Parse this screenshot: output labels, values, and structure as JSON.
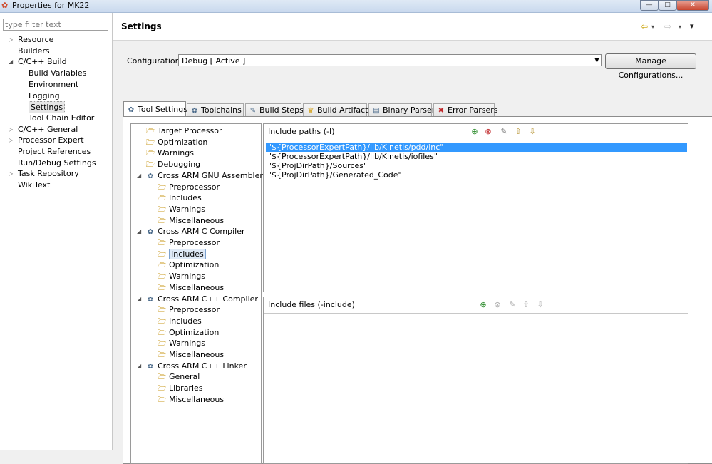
{
  "window": {
    "title": "Properties for MK22",
    "minimize": "—",
    "maximize": "□",
    "close": "✕"
  },
  "filter": {
    "placeholder": "type filter text"
  },
  "nav": [
    {
      "label": "Resource",
      "indent": 1,
      "twist": "▷"
    },
    {
      "label": "Builders",
      "indent": 1,
      "twist": ""
    },
    {
      "label": "C/C++ Build",
      "indent": 1,
      "twist": "◢"
    },
    {
      "label": "Build Variables",
      "indent": 2,
      "twist": ""
    },
    {
      "label": "Environment",
      "indent": 2,
      "twist": ""
    },
    {
      "label": "Logging",
      "indent": 2,
      "twist": ""
    },
    {
      "label": "Settings",
      "indent": 2,
      "twist": "",
      "selected": true
    },
    {
      "label": "Tool Chain Editor",
      "indent": 2,
      "twist": ""
    },
    {
      "label": "C/C++ General",
      "indent": 1,
      "twist": "▷"
    },
    {
      "label": "Processor Expert",
      "indent": 1,
      "twist": "▷"
    },
    {
      "label": "Project References",
      "indent": 1,
      "twist": ""
    },
    {
      "label": "Run/Debug Settings",
      "indent": 1,
      "twist": ""
    },
    {
      "label": "Task Repository",
      "indent": 1,
      "twist": "▷"
    },
    {
      "label": "WikiText",
      "indent": 1,
      "twist": ""
    }
  ],
  "header": {
    "title": "Settings",
    "back": "⇦",
    "forward": "⇨",
    "menu": "▾"
  },
  "config": {
    "label": "Configuration:",
    "value": "Debug  [ Active ]",
    "manage": "Manage Configurations..."
  },
  "tabs": [
    {
      "label": "Tool Settings",
      "icon": "✿",
      "active": true
    },
    {
      "label": "Toolchains",
      "icon": "✿"
    },
    {
      "label": "Build Steps",
      "icon": "✎"
    },
    {
      "label": "Build Artifact",
      "icon": "♛"
    },
    {
      "label": "Binary Parsers",
      "icon": "▤"
    },
    {
      "label": "Error Parsers",
      "icon": "✖"
    }
  ],
  "toolTree": [
    {
      "label": "Target Processor",
      "level": 0,
      "icon": "folder"
    },
    {
      "label": "Optimization",
      "level": 0,
      "icon": "folder"
    },
    {
      "label": "Warnings",
      "level": 0,
      "icon": "folder"
    },
    {
      "label": "Debugging",
      "level": 0,
      "icon": "folder"
    },
    {
      "label": "Cross ARM GNU Assembler",
      "level": 0,
      "icon": "gear",
      "twist": true
    },
    {
      "label": "Preprocessor",
      "level": 1,
      "icon": "folder"
    },
    {
      "label": "Includes",
      "level": 1,
      "icon": "folder"
    },
    {
      "label": "Warnings",
      "level": 1,
      "icon": "folder"
    },
    {
      "label": "Miscellaneous",
      "level": 1,
      "icon": "folder"
    },
    {
      "label": "Cross ARM C Compiler",
      "level": 0,
      "icon": "gear",
      "twist": true
    },
    {
      "label": "Preprocessor",
      "level": 1,
      "icon": "folder"
    },
    {
      "label": "Includes",
      "level": 1,
      "icon": "folder",
      "selected": true
    },
    {
      "label": "Optimization",
      "level": 1,
      "icon": "folder"
    },
    {
      "label": "Warnings",
      "level": 1,
      "icon": "folder"
    },
    {
      "label": "Miscellaneous",
      "level": 1,
      "icon": "folder"
    },
    {
      "label": "Cross ARM C++ Compiler",
      "level": 0,
      "icon": "gear",
      "twist": true
    },
    {
      "label": "Preprocessor",
      "level": 1,
      "icon": "folder"
    },
    {
      "label": "Includes",
      "level": 1,
      "icon": "folder"
    },
    {
      "label": "Optimization",
      "level": 1,
      "icon": "folder"
    },
    {
      "label": "Warnings",
      "level": 1,
      "icon": "folder"
    },
    {
      "label": "Miscellaneous",
      "level": 1,
      "icon": "folder"
    },
    {
      "label": "Cross ARM C++ Linker",
      "level": 0,
      "icon": "gear",
      "twist": true
    },
    {
      "label": "General",
      "level": 1,
      "icon": "folder"
    },
    {
      "label": "Libraries",
      "level": 1,
      "icon": "folder"
    },
    {
      "label": "Miscellaneous",
      "level": 1,
      "icon": "folder"
    }
  ],
  "includePaths": {
    "title": "Include paths (-I)",
    "items": [
      "\"${ProcessorExpertPath}/lib/Kinetis/pdd/inc\"",
      "\"${ProcessorExpertPath}/lib/Kinetis/iofiles\"",
      "\"${ProjDirPath}/Sources\"",
      "\"${ProjDirPath}/Generated_Code\""
    ]
  },
  "includeFiles": {
    "title": "Include files (-include)",
    "items": []
  },
  "toolbarIcons": [
    "add-icon",
    "delete-icon",
    "edit-icon",
    "move-up-icon",
    "move-down-icon"
  ],
  "colors": {
    "selection": "#3399ff",
    "treeSelection": "#dfeaf7"
  }
}
